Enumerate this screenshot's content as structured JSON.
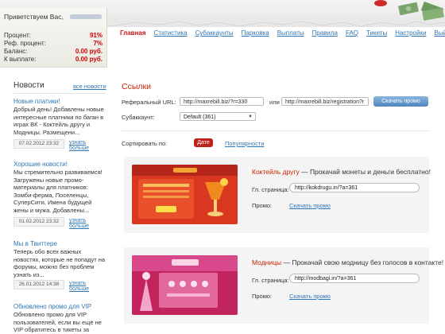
{
  "account": {
    "greeting": "Приветствуем Вас,",
    "rows": [
      {
        "label": "Процент:",
        "value": "91%"
      },
      {
        "label": "Реф. процент:",
        "value": "7%"
      },
      {
        "label": "Баланс:",
        "value": "0.00 руб."
      },
      {
        "label": "К выплате:",
        "value": "0.00 руб."
      }
    ]
  },
  "nav": [
    "Главная",
    "Статистика",
    "Субаккаунты",
    "Парковка",
    "Выплаты",
    "Правила",
    "FAQ",
    "Тикеты",
    "Настройки",
    "Выйти"
  ],
  "news": {
    "title": "Новости",
    "all_label": "все новости",
    "more_label": "узнать больше",
    "items": [
      {
        "title": "Новые платики!",
        "body": "Добрый день! Добавлены новые интересные платники по баган в играх ВК - Коктейль другу и Модницы. Размещени...",
        "date": "07.02.2012 23:32"
      },
      {
        "title": "Хорошие новости!",
        "body": "Мы стремительно развиваемся! Загружены новые промо-материалы для платников: Зомби-ферма, Поселенцы, СуперСити, Имена будущей жены и мужа. Добавлены...",
        "date": "01.02.2012 23:32"
      },
      {
        "title": "Мы в Твиттере",
        "body": "Теперь обо всех важных новостях, которые не попадут на форумы, можно без проблем узнать из...",
        "date": "26.01.2012 14:38"
      },
      {
        "title": "Обновлено промо для VIP",
        "body": "Обновлено промо для VIP пользователей, если вы ещё не VIP обратитесь в тикеты за",
        "date": ""
      }
    ]
  },
  "links": {
    "title": "Ссылки",
    "ref_label": "Реферальный URL:",
    "ref_url1": "http://maxrebill.biz/?r=330",
    "or_label": "или",
    "ref_url2": "http://maxrebill.biz/registration?r",
    "promo_button": "Скачать промо",
    "subacc_label": "Субаккаунт:",
    "subacc_value": "Default (361)"
  },
  "sort": {
    "label": "Сортировать по:",
    "date": "Дате",
    "popularity": "Популярности"
  },
  "promos": [
    {
      "name": "Коктейль другу",
      "desc": " — Прокачай монеты и деньги бесплатно!",
      "page_label": "Гл. страница:",
      "url": "http://kokdrugu.in/?a=361",
      "promo_label": "Промо:",
      "download": "Скачать промо"
    },
    {
      "name": "Модницы",
      "desc": " — Прокачай свою модницу без голосов в контакте!",
      "page_label": "Гл. страница:",
      "url": "http://modbagi.in/?a=361",
      "promo_label": "Промо:",
      "download": "Скачать промо"
    }
  ],
  "colors": {
    "accent": "#cc2200",
    "link": "#2f76b5",
    "button": "#4f85bf"
  }
}
